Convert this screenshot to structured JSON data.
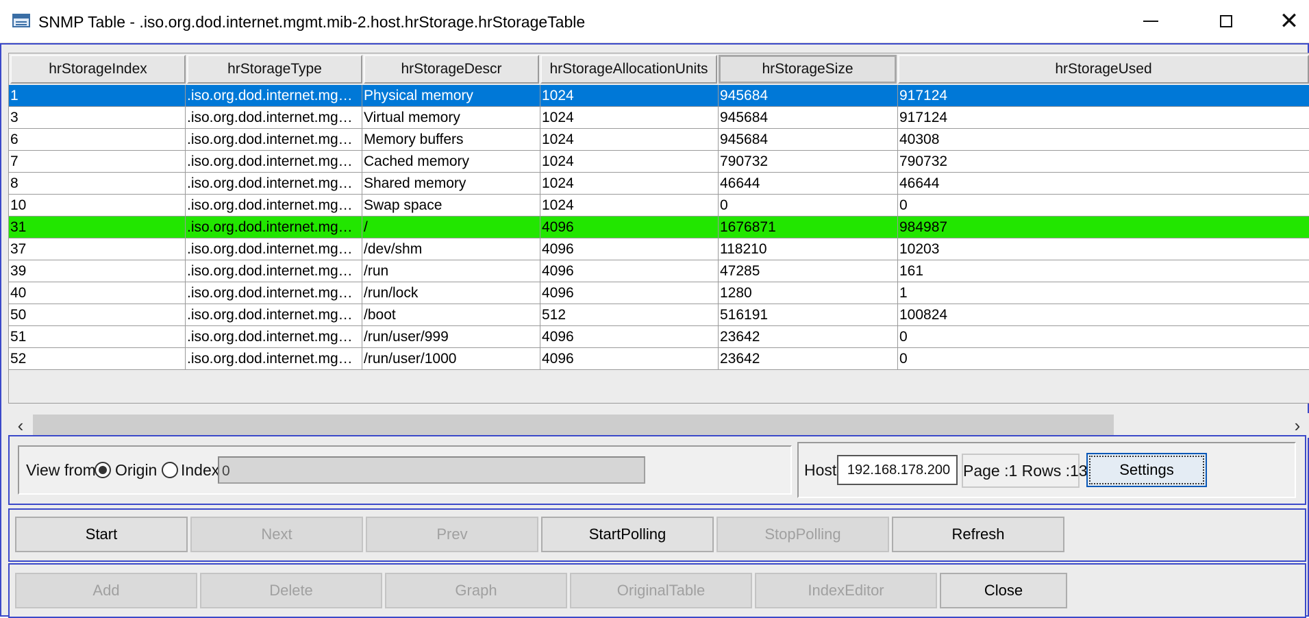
{
  "window": {
    "title": "SNMP Table - .iso.org.dod.internet.mgmt.mib-2.host.hrStorage.hrStorageTable",
    "icon": "table-window-icon"
  },
  "table": {
    "columns": [
      "hrStorageIndex",
      "hrStorageType",
      "hrStorageDescr",
      "hrStorageAllocationUnits",
      "hrStorageSize",
      "hrStorageUsed"
    ],
    "rows": [
      [
        "1",
        ".iso.org.dod.internet.mgmt.m...",
        "Physical memory",
        "1024",
        "945684",
        "917124"
      ],
      [
        "3",
        ".iso.org.dod.internet.mgmt.m...",
        "Virtual memory",
        "1024",
        "945684",
        "917124"
      ],
      [
        "6",
        ".iso.org.dod.internet.mgmt.m...",
        "Memory buffers",
        "1024",
        "945684",
        "40308"
      ],
      [
        "7",
        ".iso.org.dod.internet.mgmt.m...",
        "Cached memory",
        "1024",
        "790732",
        "790732"
      ],
      [
        "8",
        ".iso.org.dod.internet.mgmt.m...",
        "Shared memory",
        "1024",
        "46644",
        "46644"
      ],
      [
        "10",
        ".iso.org.dod.internet.mgmt.m...",
        "Swap space",
        "1024",
        "0",
        "0"
      ],
      [
        "31",
        ".iso.org.dod.internet.mgmt.m...",
        "/",
        "4096",
        "1676871",
        "984987"
      ],
      [
        "37",
        ".iso.org.dod.internet.mgmt.m...",
        "/dev/shm",
        "4096",
        "118210",
        "10203"
      ],
      [
        "39",
        ".iso.org.dod.internet.mgmt.m...",
        "/run",
        "4096",
        "47285",
        "161"
      ],
      [
        "40",
        ".iso.org.dod.internet.mgmt.m...",
        "/run/lock",
        "4096",
        "1280",
        "1"
      ],
      [
        "50",
        ".iso.org.dod.internet.mgmt.m...",
        "/boot",
        "512",
        "516191",
        "100824"
      ],
      [
        "51",
        ".iso.org.dod.internet.mgmt.m...",
        "/run/user/999",
        "4096",
        "23642",
        "0"
      ],
      [
        "52",
        ".iso.org.dod.internet.mgmt.m...",
        "/run/user/1000",
        "4096",
        "23642",
        "0"
      ]
    ],
    "selected_row": 0,
    "highlighted_row": 6,
    "selected_color": "#0078d7",
    "highlight_color": "#22e600"
  },
  "view": {
    "label": "View from",
    "origin_label": "Origin",
    "index_label": "Index",
    "index_value": "0",
    "selected": "origin",
    "host_label": "Host",
    "host_value": "192.168.178.200",
    "page_info": "Page :1 Rows :13",
    "settings_label": "Settings"
  },
  "nav_buttons": {
    "start": "Start",
    "next": "Next",
    "prev": "Prev",
    "start_polling": "StartPolling",
    "stop_polling": "StopPolling",
    "refresh": "Refresh"
  },
  "action_buttons": {
    "add": "Add",
    "delete": "Delete",
    "graph": "Graph",
    "original_table": "OriginalTable",
    "index_editor": "IndexEditor",
    "close": "Close"
  },
  "accent_color": "#3b49c9"
}
